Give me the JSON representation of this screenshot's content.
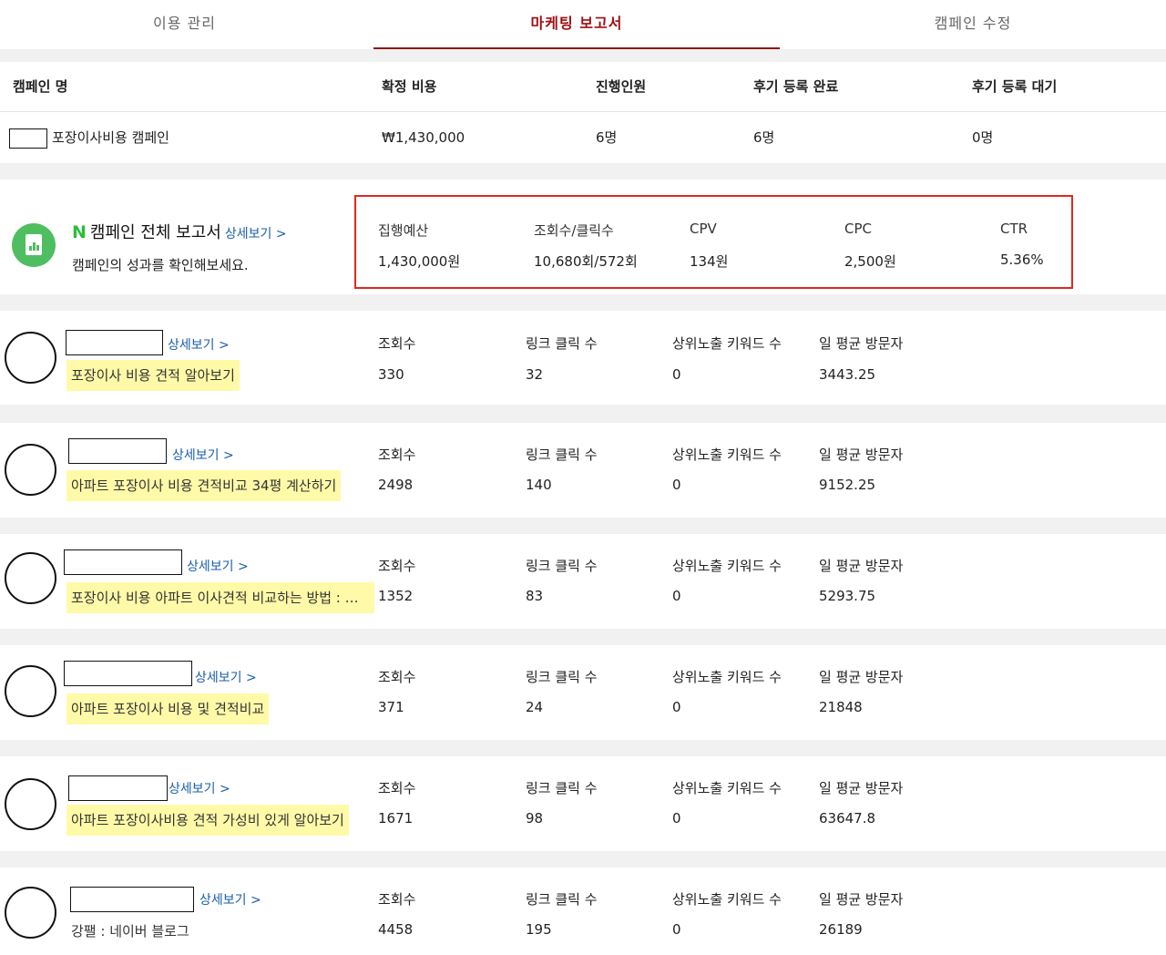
{
  "tabs": [
    {
      "label": "이용 관리"
    },
    {
      "label": "마케팅 보고서"
    },
    {
      "label": "캠페인 수정"
    }
  ],
  "summary": {
    "headers": [
      "캠페인 명",
      "확정 비용",
      "진행인원",
      "후기 등록 완료",
      "후기 등록 대기"
    ],
    "campaign_name": "포장이사비용 캠페인",
    "confirmed_cost": "₩1,430,000",
    "participants": "6명",
    "reviews_done": "6명",
    "reviews_pending": "0명"
  },
  "overall": {
    "logo_letter": "N",
    "title": "캠페인 전체 보고서",
    "detail_link": "상세보기 >",
    "description": "캠페인의 성과를 확인해보세요.",
    "metrics": [
      {
        "label": "집행예산",
        "value": "1,430,000원"
      },
      {
        "label": "조회수/클릭수",
        "value": "10,680회/572회"
      },
      {
        "label": "CPV",
        "value": "134원"
      },
      {
        "label": "CPC",
        "value": "2,500원"
      },
      {
        "label": "CTR",
        "value": "5.36%"
      }
    ]
  },
  "post_labels": {
    "views": "조회수",
    "link_clicks": "링크 클릭 수",
    "top_keywords": "상위노출 키워드 수",
    "daily_visitors": "일 평균 방문자",
    "detail_link": "상세보기 >"
  },
  "posts": [
    {
      "title": "포장이사 비용 견적 알아보기",
      "highlighted": true,
      "views": "330",
      "link_clicks": "32",
      "top_keywords": "0",
      "daily_visitors": "3443.25"
    },
    {
      "title": "아파트 포장이사 비용 견적비교 34평 계산하기",
      "highlighted": true,
      "views": "2498",
      "link_clicks": "140",
      "top_keywords": "0",
      "daily_visitors": "9152.25"
    },
    {
      "title": "포장이사 비용 아파트 이사견적 비교하는 방법 : 종...",
      "highlighted": true,
      "views": "1352",
      "link_clicks": "83",
      "top_keywords": "0",
      "daily_visitors": "5293.75"
    },
    {
      "title": "아파트 포장이사 비용 및 견적비교",
      "highlighted": true,
      "views": "371",
      "link_clicks": "24",
      "top_keywords": "0",
      "daily_visitors": "21848"
    },
    {
      "title": "아파트 포장이사비용 견적 가성비 있게 알아보기",
      "highlighted": true,
      "views": "1671",
      "link_clicks": "98",
      "top_keywords": "0",
      "daily_visitors": "63647.8"
    },
    {
      "title": "강팰 : 네이버 블로그",
      "highlighted": false,
      "views": "4458",
      "link_clicks": "195",
      "top_keywords": "0",
      "daily_visitors": "26189"
    }
  ]
}
